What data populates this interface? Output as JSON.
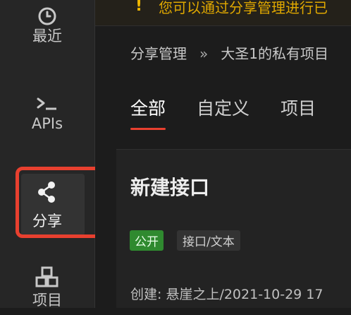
{
  "sidebar": {
    "items": [
      {
        "label": "最近",
        "icon": "clock-icon"
      },
      {
        "label": "APIs",
        "icon": "terminal-icon"
      },
      {
        "label": "分享",
        "icon": "share-icon",
        "active": true
      },
      {
        "label": "项目",
        "icon": "cubes-icon"
      }
    ]
  },
  "notice": {
    "text": "您可以通过分享管理进行已"
  },
  "breadcrumb": {
    "root": "分享管理",
    "separator": "»",
    "current": "大圣1的私有项目"
  },
  "tabs": [
    {
      "label": "全部",
      "active": true
    },
    {
      "label": "自定义"
    },
    {
      "label": "项目"
    }
  ],
  "card": {
    "title": "新建接口",
    "badge_public": "公开",
    "badge_type": "接口/文本",
    "meta": "创建: 悬崖之上/2021-10-29 17"
  },
  "colors": {
    "accent": "#e8402f",
    "warning": "#f1b800",
    "public_badge": "#2f8a2f"
  }
}
